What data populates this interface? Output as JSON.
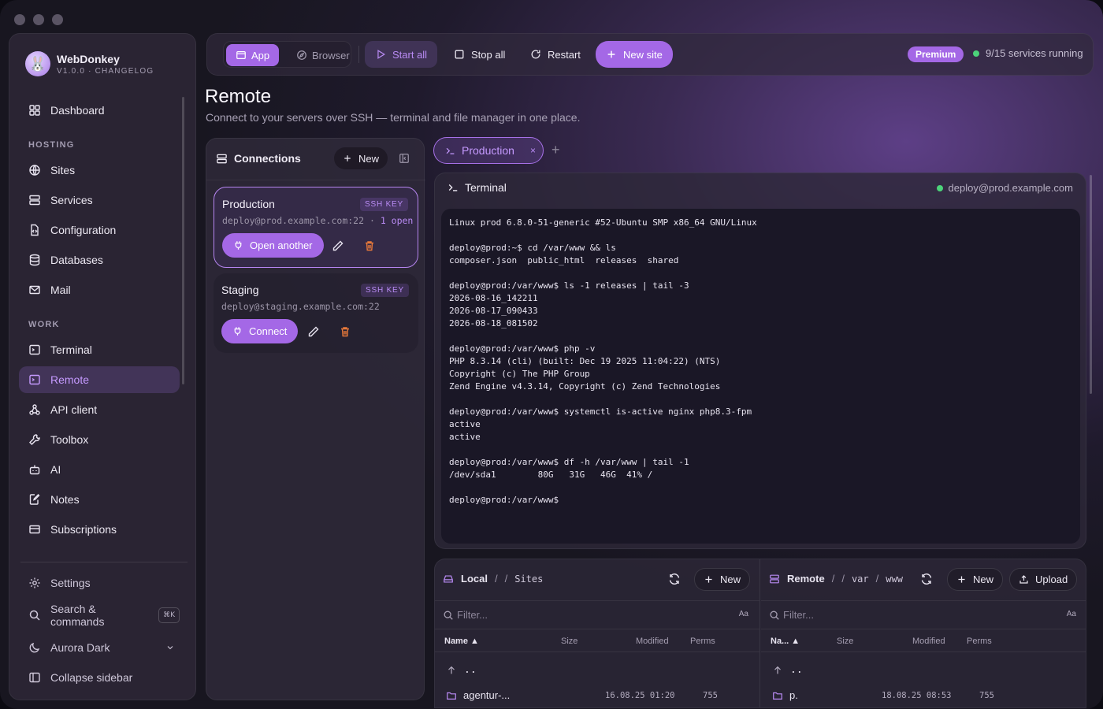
{
  "app": {
    "name": "WebDonkey",
    "version": "V1.0.0 · CHANGELOG"
  },
  "sidebar": {
    "dashboard": "Dashboard",
    "section_hosting": "HOSTING",
    "hosting": [
      "Sites",
      "Services",
      "Configuration",
      "Databases",
      "Mail"
    ],
    "section_work": "WORK",
    "work": [
      "Terminal",
      "Remote",
      "API client",
      "Toolbox",
      "AI",
      "Notes",
      "Subscriptions"
    ],
    "active": "Remote",
    "settings": "Settings",
    "search": "Search & commands",
    "search_shortcut": "⌘K",
    "theme": "Aurora Dark",
    "collapse": "Collapse sidebar"
  },
  "toolbar": {
    "mode_app": "App",
    "mode_browser": "Browser",
    "start_all": "Start all",
    "stop_all": "Stop all",
    "restart": "Restart",
    "new_site": "New site",
    "premium": "Premium",
    "services_status": "9/15 services running"
  },
  "page": {
    "title": "Remote",
    "subtitle": "Connect to your servers over SSH — terminal and file manager in one place."
  },
  "connections": {
    "title": "Connections",
    "new_label": "New",
    "items": [
      {
        "name": "Production",
        "badge": "SSH KEY",
        "address": "deploy@prod.example.com:22",
        "open_status": "1 open",
        "action": "Open another"
      },
      {
        "name": "Staging",
        "badge": "SSH KEY",
        "address": "deploy@staging.example.com:22",
        "open_status": "",
        "action": "Connect"
      }
    ]
  },
  "tabs": [
    {
      "label": "Production",
      "close": "×"
    }
  ],
  "tab_add": "+",
  "terminal": {
    "title": "Terminal",
    "host": "deploy@prod.example.com",
    "lines": [
      "Linux prod 6.8.0-51-generic #52-Ubuntu SMP x86_64 GNU/Linux",
      "",
      "deploy@prod:~$ cd /var/www && ls",
      "composer.json  public_html  releases  shared",
      "",
      "deploy@prod:/var/www$ ls -1 releases | tail -3",
      "2026-08-16_142211",
      "2026-08-17_090433",
      "2026-08-18_081502",
      "",
      "deploy@prod:/var/www$ php -v",
      "PHP 8.3.14 (cli) (built: Dec 19 2025 11:04:22) (NTS)",
      "Copyright (c) The PHP Group",
      "Zend Engine v4.3.14, Copyright (c) Zend Technologies",
      "",
      "deploy@prod:/var/www$ systemctl is-active nginx php8.3-fpm",
      "active",
      "active",
      "",
      "deploy@prod:/var/www$ df -h /var/www | tail -1",
      "/dev/sda1        80G   31G   46G  41% /",
      "",
      "deploy@prod:/var/www$"
    ]
  },
  "files": {
    "local": {
      "root": "Local",
      "path": [
        "/",
        "Sites"
      ],
      "new_label": "New",
      "filter_placeholder": "Filter...",
      "case_label": "Aa",
      "columns": {
        "name": "Name ▲",
        "size": "Size",
        "modified": "Modified",
        "perms": "Perms"
      },
      "up": "..",
      "rows": [
        {
          "name": "agentur-...",
          "size": "",
          "modified": "16.08.25 01:20",
          "perms": "755"
        }
      ]
    },
    "remote": {
      "root": "Remote",
      "path": [
        "/",
        "var",
        "www"
      ],
      "new_label": "New",
      "upload_label": "Upload",
      "filter_placeholder": "Filter...",
      "case_label": "Aa",
      "columns": {
        "name": "Na... ▲",
        "size": "Size",
        "modified": "Modified",
        "perms": "Perms"
      },
      "up": "..",
      "rows": [
        {
          "name": "p.",
          "size": "",
          "modified": "18.08.25 08:53",
          "perms": "755"
        }
      ]
    }
  },
  "colors": {
    "accent": "#a468e6",
    "accent_text": "#c59aff",
    "status_green": "#4cd37a",
    "danger": "#e8793a"
  }
}
